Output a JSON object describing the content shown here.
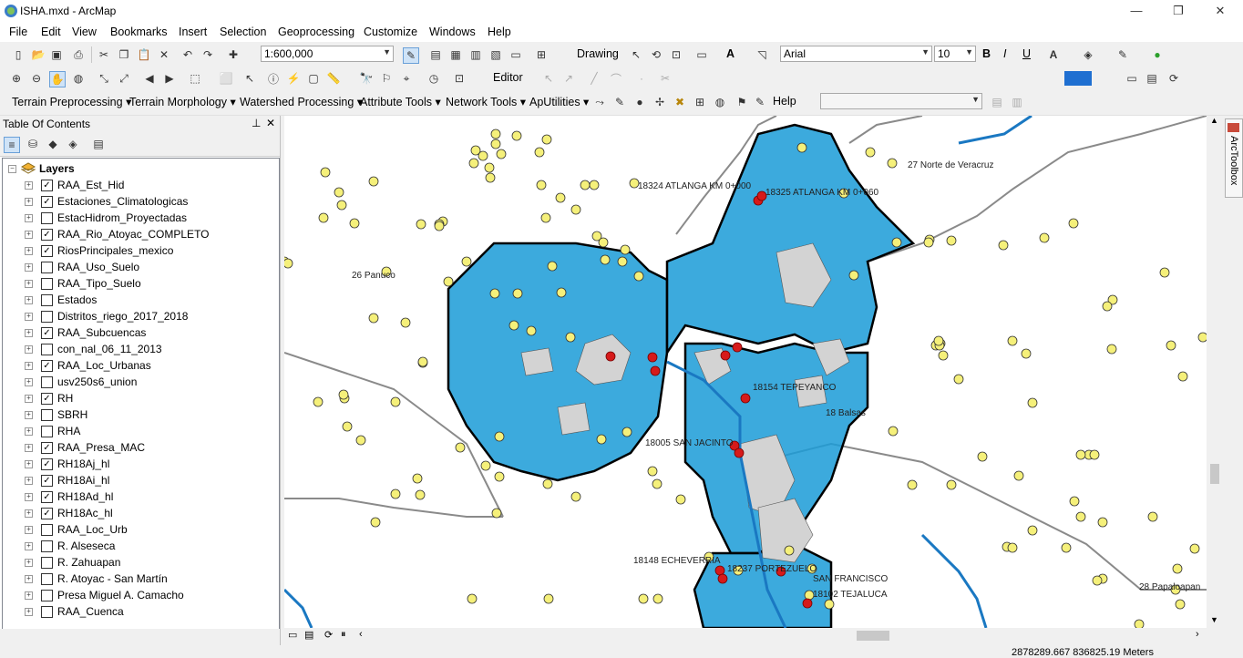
{
  "window": {
    "title": "ISHA.mxd - ArcMap",
    "minimize": "—",
    "restore": "❐",
    "close": "✕"
  },
  "menu": [
    "File",
    "Edit",
    "View",
    "Bookmarks",
    "Insert",
    "Selection",
    "Geoprocessing",
    "Customize",
    "Windows",
    "Help"
  ],
  "toolbar": {
    "scale": "1:600,000",
    "drawing_label": "Drawing",
    "font_name": "Arial",
    "font_size": "10",
    "bold": "B",
    "italic": "I",
    "underline": "U",
    "text_a": "A",
    "editor_label": "Editor"
  },
  "toolbar3": {
    "items": [
      "Terrain Preprocessing",
      "Terrain Morphology",
      "Watershed Processing",
      "Attribute Tools",
      "Network Tools",
      "ApUtilities"
    ],
    "help_label": "Help"
  },
  "toc": {
    "title": "Table Of Contents",
    "pin": "⊥",
    "close": "✕",
    "root_label": "Layers",
    "layers": [
      {
        "name": "RAA_Est_Hid",
        "checked": true
      },
      {
        "name": "Estaciones_Climatologicas",
        "checked": true
      },
      {
        "name": "EstacHidrom_Proyectadas",
        "checked": false
      },
      {
        "name": "RAA_Rio_Atoyac_COMPLETO",
        "checked": true
      },
      {
        "name": "RiosPrincipales_mexico",
        "checked": true
      },
      {
        "name": "RAA_Uso_Suelo",
        "checked": false
      },
      {
        "name": "RAA_Tipo_Suelo",
        "checked": false
      },
      {
        "name": "Estados",
        "checked": false
      },
      {
        "name": "Distritos_riego_2017_2018",
        "checked": false
      },
      {
        "name": "RAA_Subcuencas",
        "checked": true
      },
      {
        "name": "con_nal_06_11_2013",
        "checked": false
      },
      {
        "name": "RAA_Loc_Urbanas",
        "checked": true
      },
      {
        "name": "usv250s6_union",
        "checked": false
      },
      {
        "name": "RH",
        "checked": true
      },
      {
        "name": "SBRH",
        "checked": false
      },
      {
        "name": "RHA",
        "checked": false
      },
      {
        "name": "RAA_Presa_MAC",
        "checked": true
      },
      {
        "name": "RH18Aj_hl",
        "checked": true
      },
      {
        "name": "RH18Ai_hl",
        "checked": true
      },
      {
        "name": "RH18Ad_hl",
        "checked": true
      },
      {
        "name": "RH18Ac_hl",
        "checked": true
      },
      {
        "name": "RAA_Loc_Urb",
        "checked": false
      },
      {
        "name": "R. Alseseca",
        "checked": false
      },
      {
        "name": "R. Zahuapan",
        "checked": false
      },
      {
        "name": "R. Atoyac - San Martín",
        "checked": false
      },
      {
        "name": "Presa Miguel A. Camacho",
        "checked": false
      },
      {
        "name": "RAA_Cuenca",
        "checked": false
      }
    ]
  },
  "map_labels": [
    {
      "text": "27 Norte de Veracruz"
    },
    {
      "text": "26 Panuco"
    },
    {
      "text": "18324 ATLANGA KM 0+000"
    },
    {
      "text": "18325 ATLANGA KM 0+060"
    },
    {
      "text": "18148 ECHEVERRIA"
    },
    {
      "text": "18237 PORTEZUELO"
    },
    {
      "text": "SAN FRANCISCO"
    },
    {
      "text": "18102 TEJALUCA"
    },
    {
      "text": "28 Papaloapan"
    },
    {
      "text": "18005 SAN JACINTO"
    },
    {
      "text": "18154 TEPEYANCO"
    },
    {
      "text": "18 Balsas"
    }
  ],
  "arctoolbox_label": "ArcToolbox",
  "status": {
    "coordinates": "2878289.667  836825.19 Meters"
  },
  "colors": {
    "river": "#1a9bd7",
    "urban": "#d3d3d3",
    "station": "#f5f07a",
    "hydro_station": "#d61a1a",
    "boundary": "#000000"
  }
}
